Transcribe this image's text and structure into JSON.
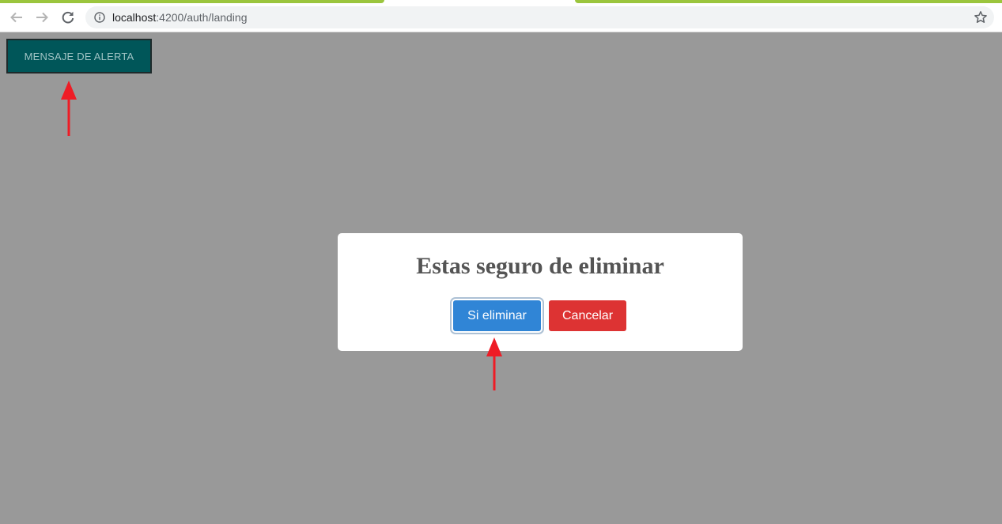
{
  "browser": {
    "url_host": "localhost",
    "url_rest": ":4200/auth/landing",
    "icons": {
      "back": "arrow-left-icon",
      "forward": "arrow-right-icon",
      "reload": "reload-icon",
      "info": "info-icon",
      "bookmark": "star-icon"
    },
    "tab_accent_color": "#9bc53d"
  },
  "page": {
    "alert_button_label": "MENSAJE DE ALERTA",
    "alert_button_color": "#005659",
    "overlay_color": "#999999"
  },
  "modal": {
    "title": "Estas seguro de eliminar",
    "confirm_label": "Si eliminar",
    "cancel_label": "Cancelar",
    "confirm_color": "#3085d6",
    "cancel_color": "#dd3333"
  },
  "annotations": {
    "arrow_color": "#ee1c25"
  }
}
